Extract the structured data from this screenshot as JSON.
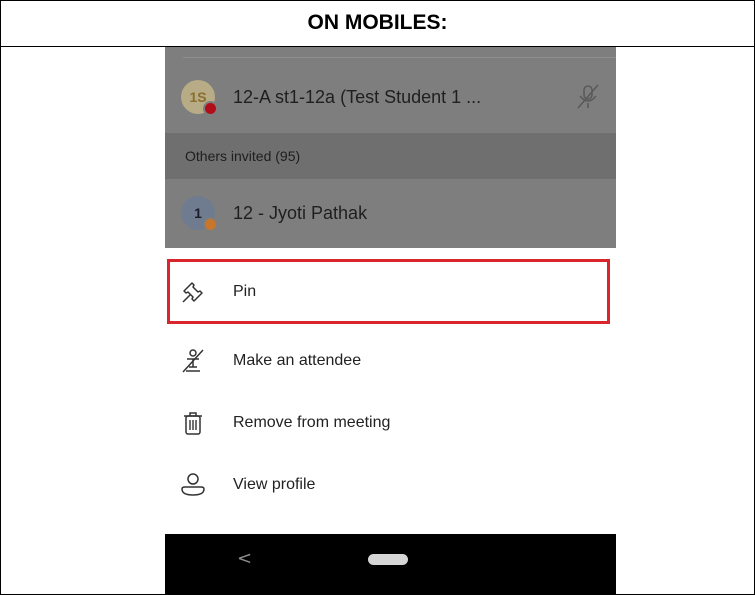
{
  "header": {
    "title": "ON MOBILES:"
  },
  "participants": [
    {
      "initials": "1S",
      "name": "12-A st1-12a (Test Student 1 ...",
      "avatar_bg": "#b8ac86",
      "status_color": "#b10e1a",
      "initials_color": "#8a6e2e",
      "muted": true
    },
    {
      "initials": "1",
      "name": "12 - Jyoti Pathak",
      "avatar_bg": "#6f7b8e",
      "status_color": "#c9762a",
      "initials_color": "#1e1e2a"
    }
  ],
  "section": {
    "label": "Others invited (95)"
  },
  "menu": [
    {
      "label": "Pin",
      "icon": "pin-icon",
      "highlighted": true
    },
    {
      "label": "Make an attendee",
      "icon": "make-attendee-icon"
    },
    {
      "label": "Remove from meeting",
      "icon": "trash-icon"
    },
    {
      "label": "View profile",
      "icon": "person-icon"
    }
  ],
  "colors": {
    "highlight": "#d9262c",
    "overlay": "#7e7e7e",
    "navbar": "#000000"
  },
  "navbar": {
    "back_glyph": "<"
  }
}
